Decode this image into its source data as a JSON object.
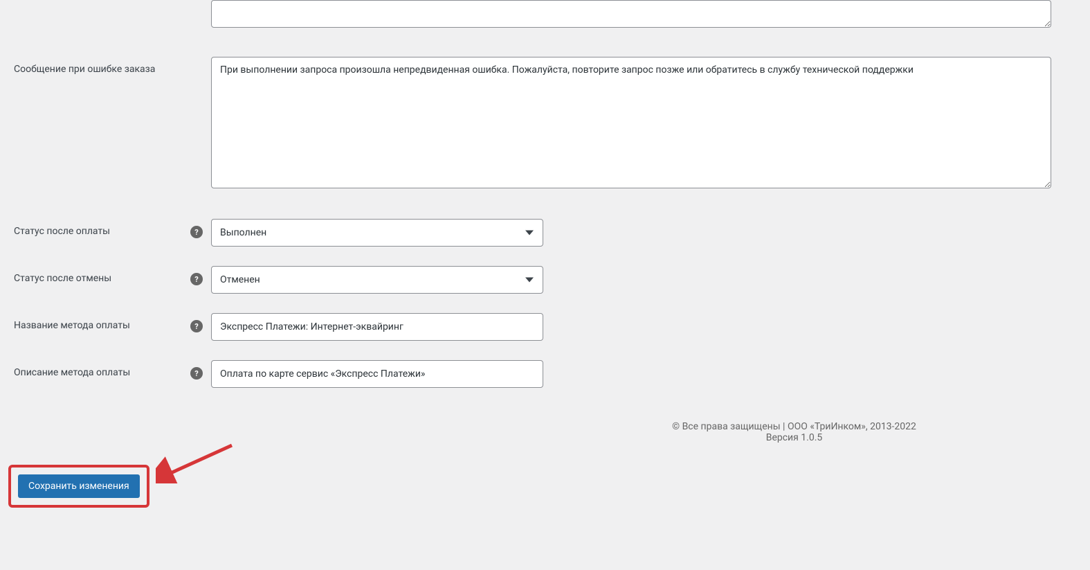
{
  "form": {
    "empty_textarea_label": "",
    "error_message_label": "Сообщение при ошибке заказа",
    "error_message_value": "При выполнении запроса произошла непредвиденная ошибка. Пожалуйста, повторите запрос позже или обратитесь в службу технической поддержки",
    "status_after_payment_label": "Статус после оплаты",
    "status_after_payment_value": "Выполнен",
    "status_after_cancel_label": "Статус после отмены",
    "status_after_cancel_value": "Отменен",
    "payment_method_name_label": "Название метода оплаты",
    "payment_method_name_value": "Экспресс Платежи: Интернет-эквайринг",
    "payment_method_desc_label": "Описание метода оплаты",
    "payment_method_desc_value": "Оплата по карте сервис «Экспресс Платежи»",
    "save_button_label": "Сохранить изменения"
  },
  "footer": {
    "copyright": "© Все права защищены | ООО «ТриИнком», 2013-2022",
    "version": "Версия 1.0.5"
  }
}
